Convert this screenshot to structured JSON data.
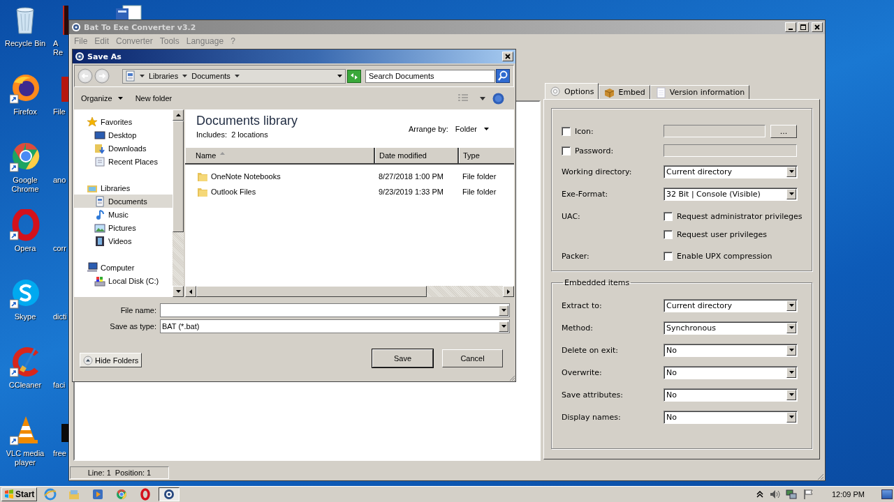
{
  "desktop": {
    "icons": [
      {
        "label": "Recycle Bin",
        "kind": "recycle-bin"
      },
      {
        "label": "Firefox",
        "kind": "firefox"
      },
      {
        "label": "Google Chrome",
        "kind": "chrome"
      },
      {
        "label": "Opera",
        "kind": "opera"
      },
      {
        "label": "Skype",
        "kind": "skype"
      },
      {
        "label": "CCleaner",
        "kind": "ccleaner"
      },
      {
        "label": "VLC media player",
        "kind": "vlc"
      }
    ],
    "partial_icons": [
      {
        "label": "A Re",
        "kind": "dark-app"
      },
      {
        "label": "File",
        "kind": "red-app"
      },
      {
        "label": "ano",
        "kind": "hidden"
      },
      {
        "label": "corr",
        "kind": "hidden"
      },
      {
        "label": "dicti",
        "kind": "hidden"
      },
      {
        "label": "faci",
        "kind": "hidden"
      },
      {
        "label": "free",
        "kind": "black-app"
      }
    ]
  },
  "main_window": {
    "title": "Bat To Exe Converter v3.2",
    "menu": [
      "File",
      "Edit",
      "Converter",
      "Tools",
      "Language",
      "?"
    ],
    "tabs": [
      {
        "label": "Options",
        "kind": "gear",
        "selected": true
      },
      {
        "label": "Embed",
        "kind": "box",
        "selected": false
      },
      {
        "label": "Version information",
        "kind": "page",
        "selected": false
      }
    ],
    "options": [
      {
        "kind": "checkbox-field",
        "label": "Icon:",
        "checked": false,
        "browse": "..."
      },
      {
        "kind": "checkbox-field",
        "label": "Password:",
        "checked": false
      },
      {
        "kind": "select",
        "label": "Working directory:",
        "value": "Current directory"
      },
      {
        "kind": "select",
        "label": "Exe-Format:",
        "value": "32 Bit | Console (Visible)"
      },
      {
        "kind": "checks",
        "label": "UAC:",
        "options": [
          {
            "label": "Request administrator privileges",
            "checked": false
          },
          {
            "label": "Request user privileges",
            "checked": false
          }
        ]
      },
      {
        "kind": "checks",
        "label": "Packer:",
        "options": [
          {
            "label": "Enable UPX compression",
            "checked": false
          }
        ]
      }
    ],
    "embedded_items": {
      "title": "Embedded items",
      "rows": [
        {
          "kind": "select",
          "label": "Extract to:",
          "value": "Current directory"
        },
        {
          "kind": "select",
          "label": "Method:",
          "value": "Synchronous"
        },
        {
          "kind": "select",
          "label": "Delete on exit:",
          "value": "No"
        },
        {
          "kind": "select",
          "label": "Overwrite:",
          "value": "No"
        },
        {
          "kind": "select",
          "label": "Save attributes:",
          "value": "No"
        },
        {
          "kind": "select",
          "label": "Display names:",
          "value": "No"
        }
      ]
    },
    "status_bar": "Line: 1  Position: 1"
  },
  "save_as": {
    "title": "Save As",
    "breadcrumb": [
      "Libraries",
      "Documents"
    ],
    "search": {
      "placeholder": "Search Documents"
    },
    "toolbar": [
      "Organize",
      "New folder"
    ],
    "nav": [
      {
        "label": "Favorites",
        "kind": "star",
        "selected": false,
        "children": [
          {
            "label": "Desktop",
            "kind": "desktop",
            "selected": false
          },
          {
            "label": "Downloads",
            "kind": "downloads",
            "selected": false
          },
          {
            "label": "Recent Places",
            "kind": "recent",
            "selected": false
          }
        ]
      },
      {
        "label": "Libraries",
        "kind": "libraries",
        "selected": false,
        "children": [
          {
            "label": "Documents",
            "kind": "documents",
            "selected": true
          },
          {
            "label": "Music",
            "kind": "music",
            "selected": false
          },
          {
            "label": "Pictures",
            "kind": "pictures",
            "selected": false
          },
          {
            "label": "Videos",
            "kind": "videos",
            "selected": false
          }
        ]
      },
      {
        "label": "Computer",
        "kind": "computer",
        "selected": false,
        "children": [
          {
            "label": "Local Disk (C:)",
            "kind": "disk",
            "selected": false
          }
        ]
      }
    ],
    "library": {
      "title": "Documents library",
      "includes": "Includes:  2 locations",
      "arrange_label": "Arrange by:",
      "arrange_value": "Folder"
    },
    "columns": [
      "Name",
      "Date modified",
      "Type"
    ],
    "rows": [
      {
        "name": "OneNote Notebooks",
        "date": "8/27/2018 1:00 PM",
        "type": "File folder"
      },
      {
        "name": "Outlook Files",
        "date": "9/23/2019 1:33 PM",
        "type": "File folder"
      }
    ],
    "file_name_label": "File name:",
    "save_type_label": "Save as type:",
    "save_type_value": "BAT (*.bat)",
    "hide_folders": "Hide Folders",
    "buttons": [
      "Save",
      "Cancel"
    ]
  },
  "taskbar": {
    "start": "Start",
    "apps": [
      {
        "kind": "ie",
        "active": false
      },
      {
        "kind": "folder",
        "active": false
      },
      {
        "kind": "media",
        "active": false
      },
      {
        "kind": "chrome",
        "active": false
      },
      {
        "kind": "opera",
        "active": false
      },
      {
        "kind": "gear",
        "active": true
      }
    ],
    "clock": "12:09 PM"
  }
}
